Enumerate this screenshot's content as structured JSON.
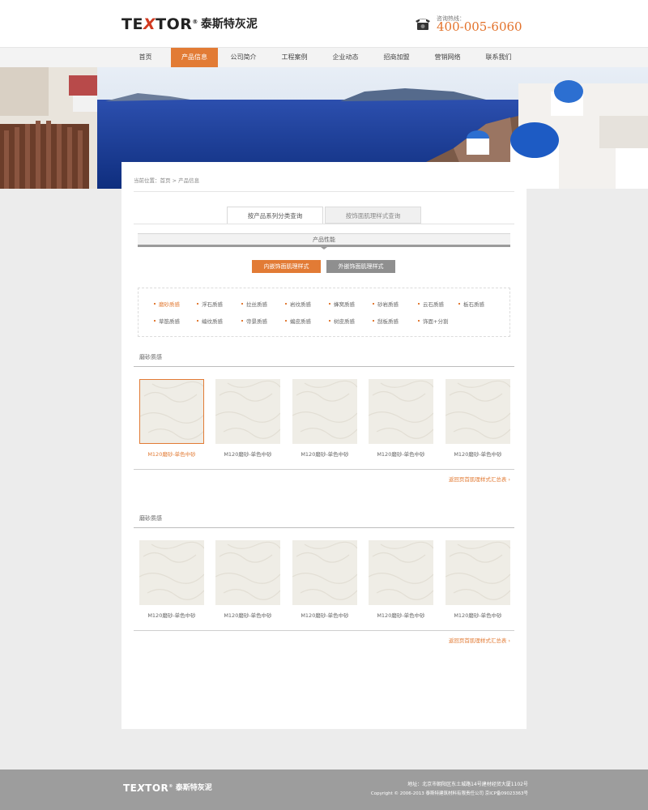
{
  "header": {
    "logo_mark_a": "TE",
    "logo_mark_x": "X",
    "logo_mark_b": "TOR",
    "logo_reg": "®",
    "logo_cn": "泰斯特灰泥",
    "phone_label": "咨询热线：",
    "phone_number": "400-005-6060"
  },
  "nav": {
    "items": [
      "首页",
      "产品信息",
      "公司简介",
      "工程案例",
      "企业动态",
      "招商加盟",
      "营销网络",
      "联系我们"
    ],
    "active_index": 1
  },
  "breadcrumb": "当前位置：首页 > 产品信息",
  "tabs": {
    "active": "按产品系列分类查询",
    "inactive": "按饰面肌理样式查询"
  },
  "property_bar": {
    "title": "产品性能"
  },
  "type_buttons": {
    "inner": "内嵌饰面肌理样式",
    "outer": "外嵌饰面肌理样式"
  },
  "filters": {
    "row1": [
      "磨砂质感",
      "浮石质感",
      "拉丝质感",
      "岩纹质感",
      "蜂窝质感",
      "砂岩质感",
      "云石质感",
      "板石质感"
    ],
    "row2": [
      "草筋质感",
      "编纹质感",
      "帝景质感",
      "蝙皮质感",
      "树皮质感",
      "刮板质感",
      "饰面+分割"
    ],
    "selected": "磨砂质感"
  },
  "sections": [
    {
      "title": "磨砂质感",
      "products": [
        "M120磨砂-单色中砂",
        "M120磨砂-单色中砂",
        "M120磨砂-单色中砂",
        "M120磨砂-单色中砂",
        "M120磨砂-单色中砂"
      ],
      "selected_index": 0,
      "back_link": "返回页首肌理样式汇总表"
    },
    {
      "title": "磨砂质感",
      "products": [
        "M120磨砂-单色中砂",
        "M120磨砂-单色中砂",
        "M120磨砂-单色中砂",
        "M120磨砂-单色中砂",
        "M120磨砂-单色中砂"
      ],
      "selected_index": -1,
      "back_link": "返回页首肌理样式汇总表"
    }
  ],
  "footer": {
    "address": "地址：北京市朝阳区东土城路14号建材经贸大厦1102号",
    "copyright": "Copyright © 2006-2013  泰斯特建筑材料有限责任公司   京ICP备09023363号"
  },
  "colors": {
    "accent": "#e27b35",
    "footer_bg": "#9d9d9d",
    "thumb": "#efede6"
  },
  "icons": {
    "phone": "telephone-icon",
    "back_arrow": "chevron-right-icon"
  }
}
